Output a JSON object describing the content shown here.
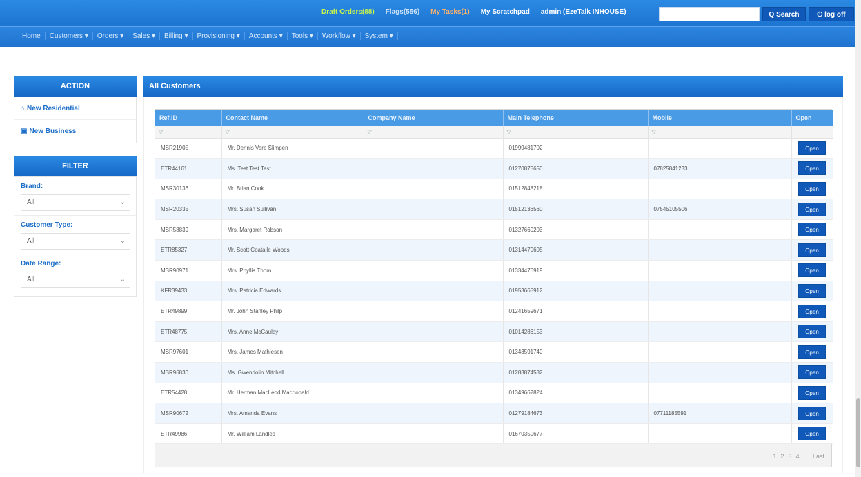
{
  "header": {
    "draft_orders": "Draft Orders(88)",
    "flags": "Flags(556)",
    "warning_link": "My Tasks(1)",
    "my_scratchpad": "My Scratchpad",
    "admin": "admin (EzeTalk INHOUSE)",
    "search_placeholder": "",
    "search_button": "Q Search",
    "logoff_button": "⏻ log off"
  },
  "nav": {
    "items": [
      "Home",
      "Customers ▾",
      "Orders ▾",
      "Sales ▾",
      "Billing ▾",
      "Provisioning ▾",
      "Accounts ▾",
      "Tools ▾",
      "Workflow ▾",
      "System ▾"
    ]
  },
  "sidebar": {
    "action_title": "ACTION",
    "new_residential": "New Residential",
    "new_business": "New Business",
    "filter_title": "FILTER",
    "brand_label": "Brand:",
    "brand_value": "All",
    "customer_type_label": "Customer Type:",
    "customer_type_value": "All",
    "date_range_label": "Date Range:",
    "date_range_value": "All"
  },
  "main": {
    "title": "All Customers",
    "columns": [
      "Ref.ID",
      "Contact Name",
      "Company Name",
      "Main Telephone",
      "Mobile",
      "Open"
    ],
    "open_label": "Open",
    "rows": [
      {
        "ref": "MSR21905",
        "name": "Mr. Dennis Vere Slimpen",
        "company": "",
        "phone": "01999481702",
        "mobile": ""
      },
      {
        "ref": "ETR44161",
        "name": "Ms. Test Test Test",
        "company": "",
        "phone": "01270875650",
        "mobile": "07825841233"
      },
      {
        "ref": "MSR30136",
        "name": "Mr. Brian Cook",
        "company": "",
        "phone": "01512848218",
        "mobile": ""
      },
      {
        "ref": "MSR20335",
        "name": "Mrs. Susan Sullivan",
        "company": "",
        "phone": "01512136560",
        "mobile": "07545105506"
      },
      {
        "ref": "MSR58839",
        "name": "Mrs. Margaret Robson",
        "company": "",
        "phone": "01327660203",
        "mobile": ""
      },
      {
        "ref": "ETR85327",
        "name": "Mr. Scott Coatalle Woods",
        "company": "",
        "phone": "01314470605",
        "mobile": ""
      },
      {
        "ref": "MSR90971",
        "name": "Mrs. Phyllis Thorn",
        "company": "",
        "phone": "01334476919",
        "mobile": ""
      },
      {
        "ref": "KFR39433",
        "name": "Mrs. Patricia Edwards",
        "company": "",
        "phone": "01953665912",
        "mobile": ""
      },
      {
        "ref": "ETR49899",
        "name": "Mr. John Stanley Philp",
        "company": "",
        "phone": "01241659671",
        "mobile": ""
      },
      {
        "ref": "ETR48775",
        "name": "Mrs. Anne McCauley",
        "company": "",
        "phone": "01014286153",
        "mobile": ""
      },
      {
        "ref": "MSR97601",
        "name": "Mrs. James Mathiesen",
        "company": "",
        "phone": "01343591740",
        "mobile": ""
      },
      {
        "ref": "MSR96830",
        "name": "Ms. Gwendolin Mitchell",
        "company": "",
        "phone": "01283874532",
        "mobile": ""
      },
      {
        "ref": "ETR54428",
        "name": "Mr. Herman MacLeod Macdonald",
        "company": "",
        "phone": "01349662824",
        "mobile": ""
      },
      {
        "ref": "MSR90672",
        "name": "Mrs. Amanda Evans",
        "company": "",
        "phone": "01279184673",
        "mobile": "07711185591"
      },
      {
        "ref": "ETR49986",
        "name": "Mr. William Landles",
        "company": "",
        "phone": "01670350677",
        "mobile": ""
      }
    ],
    "pager": [
      "1",
      "2",
      "3",
      "4",
      "...",
      "Last"
    ]
  },
  "colors": {
    "primary": "#1d74d1",
    "button": "#1059b8",
    "accent_link": "#1d6fc9"
  }
}
